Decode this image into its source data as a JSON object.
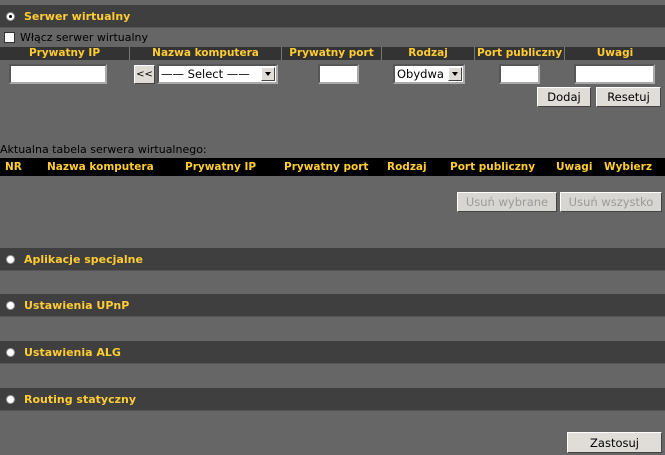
{
  "sections": {
    "virtual_server": "Serwer wirtualny",
    "special_apps": "Aplikacje specjalne",
    "upnp": "Ustawienia UPnP",
    "alg": "Ustawienia ALG",
    "static_routing": "Routing statyczny"
  },
  "enable_checkbox": {
    "label": "Włącz serwer wirtualny",
    "checked": false
  },
  "form": {
    "headers": [
      "Prywatny IP",
      "Nazwa komputera",
      "Prywatny port",
      "Rodzaj",
      "Port publiczny",
      "Uwagi"
    ],
    "private_ip": "",
    "copy_button": "<<",
    "computer_select": "—— Select ——",
    "private_port": "",
    "type_select": "Obydwa",
    "public_port": "",
    "remarks": "",
    "add_button": "Dodaj",
    "reset_button": "Resetuj"
  },
  "table": {
    "caption": "Aktualna tabela serwera wirtualnego:",
    "headers": [
      "NR",
      "Nazwa komputera",
      "Prywatny IP",
      "Prywatny port",
      "Rodzaj",
      "Port publiczny",
      "Uwagi",
      "Wybierz"
    ],
    "delete_selected": "Usuń wybrane",
    "delete_all": "Usuń wszystko"
  },
  "apply_button": "Zastosuj",
  "colors": {
    "background": "#666666",
    "section_bar": "#3f3f3f",
    "accent": "#ffcc33"
  }
}
